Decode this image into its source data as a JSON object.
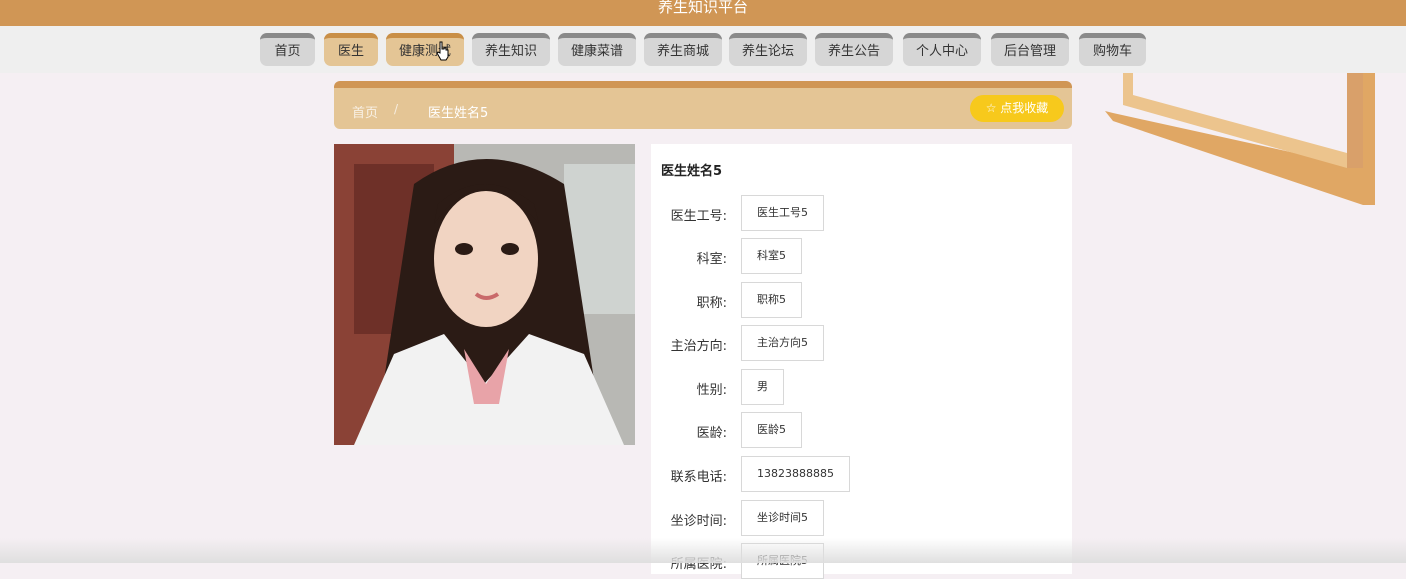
{
  "site": {
    "title": "养生知识平台"
  },
  "nav": {
    "items": [
      {
        "label": "首页"
      },
      {
        "label": "医生"
      },
      {
        "label": "健康测试"
      },
      {
        "label": "养生知识"
      },
      {
        "label": "健康菜谱"
      },
      {
        "label": "养生商城"
      },
      {
        "label": "养生论坛"
      },
      {
        "label": "养生公告"
      },
      {
        "label": "个人中心"
      },
      {
        "label": "后台管理"
      },
      {
        "label": "购物车"
      }
    ],
    "active_index": 1,
    "hover_index": 2
  },
  "breadcrumb": {
    "home": "首页",
    "separator": "/",
    "current": "医生姓名5"
  },
  "favorite_button": {
    "label": "☆ 点我收藏"
  },
  "doctor": {
    "name": "医生姓名5",
    "fields": [
      {
        "label": "医生工号:",
        "value": "医生工号5"
      },
      {
        "label": "科室:",
        "value": "科室5"
      },
      {
        "label": "职称:",
        "value": "职称5"
      },
      {
        "label": "主治方向:",
        "value": "主治方向5"
      },
      {
        "label": "性别:",
        "value": "男"
      },
      {
        "label": "医龄:",
        "value": "医龄5"
      },
      {
        "label": "联系电话:",
        "value": "13823888885"
      },
      {
        "label": "坐诊时间:",
        "value": "坐诊时间5"
      },
      {
        "label": "所属医院:",
        "value": "所属医院5"
      }
    ]
  },
  "colors": {
    "brand": "#d09655",
    "crumb_bg": "#e4c595",
    "favorite": "#f7c91c",
    "page_bg": "#f5eff3"
  },
  "icons": {
    "cursor": "hand-pointer-icon",
    "favorite": "star-outline-icon"
  }
}
